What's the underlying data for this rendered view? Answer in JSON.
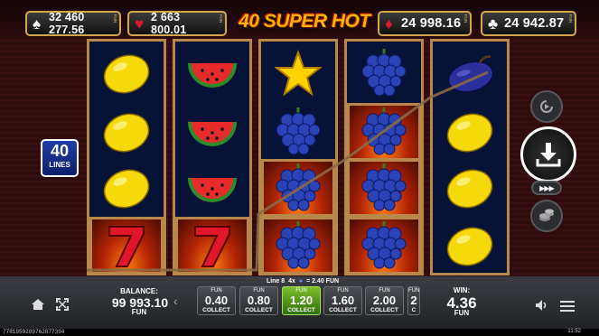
{
  "title": "40 SUPER HOT",
  "jackpots": [
    {
      "suit": "♠",
      "value": "32 460 277.56",
      "color": "#ffffff",
      "tag": "FUN"
    },
    {
      "suit": "♥",
      "value": "2 663 800.01",
      "color": "#e0162b",
      "tag": "FUN"
    },
    {
      "suit": "♦",
      "value": "24 998.16",
      "color": "#e0162b",
      "tag": "FUN"
    },
    {
      "suit": "♣",
      "value": "24 942.87",
      "color": "#ffffff",
      "tag": "FUN"
    }
  ],
  "lines": {
    "count": "40",
    "label": "LINES"
  },
  "reels": [
    [
      "lemon",
      "lemon",
      "lemon",
      "seven"
    ],
    [
      "watermelon",
      "watermelon",
      "watermelon",
      "seven"
    ],
    [
      "star",
      "grapes",
      "grapes",
      "grapes"
    ],
    [
      "grapes",
      "grapes",
      "grapes",
      "grapes"
    ],
    [
      "plum",
      "lemon",
      "lemon",
      "lemon"
    ]
  ],
  "winning_cells": [
    [
      0,
      3
    ],
    [
      1,
      3
    ],
    [
      2,
      2
    ],
    [
      2,
      3
    ],
    [
      3,
      1
    ],
    [
      3,
      2
    ],
    [
      3,
      3
    ]
  ],
  "win_line": {
    "line": "Line 8",
    "mult": "4x",
    "equals": "= 2.40 FUN"
  },
  "balance": {
    "label": "BALANCE:",
    "value": "99 993.10",
    "currency": "FUN"
  },
  "bets": [
    {
      "currency": "FUN",
      "value": "0.40",
      "action": "COLLECT",
      "selected": false
    },
    {
      "currency": "FUN",
      "value": "0.80",
      "action": "COLLECT",
      "selected": false
    },
    {
      "currency": "FUN",
      "value": "1.20",
      "action": "COLLECT",
      "selected": true
    },
    {
      "currency": "FUN",
      "value": "1.60",
      "action": "COLLECT",
      "selected": false
    },
    {
      "currency": "FUN",
      "value": "2.00",
      "action": "COLLECT",
      "selected": false
    },
    {
      "currency": "FUN",
      "value": "2",
      "action": "C",
      "selected": false
    }
  ],
  "win": {
    "label": "WIN:",
    "value": "4.36",
    "currency": "FUN"
  },
  "footer": {
    "ticket": "7781959289762877394",
    "time": "11:52"
  },
  "colors": {
    "frame": "#b8874a",
    "reel_bg": "#071336",
    "selected_bet": "#5fae1c",
    "title": "#ffb400"
  }
}
